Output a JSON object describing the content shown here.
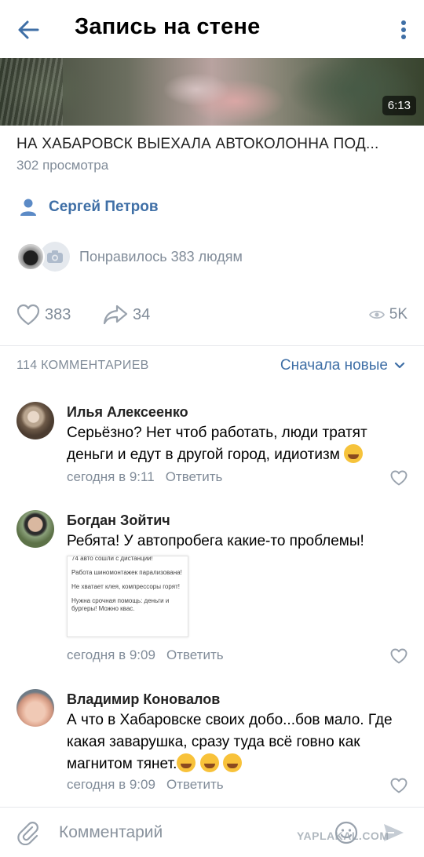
{
  "header": {
    "title": "Запись на стене"
  },
  "video": {
    "duration": "6:13",
    "title": "НА ХАБАРОВСК ВЫЕХАЛА АВТОКОЛОННА ПОД...",
    "views": "302 просмотра"
  },
  "author": {
    "name": "Сергей Петров"
  },
  "likes_summary": {
    "text": "Понравилось 383 людям"
  },
  "actions": {
    "likes": "383",
    "shares": "34",
    "views": "5K"
  },
  "comments_section": {
    "count_label": "114 КОММЕНТАРИЕВ",
    "sort_label": "Сначала новые"
  },
  "comments": [
    {
      "name": "Илья Алексеенко",
      "text_line1": "Серьёзно? Нет чтоб работать, люди тратят",
      "text_line2": "деньги и едут в другой город, идиотизм",
      "time": "сегодня в 9:11",
      "reply": "Ответить"
    },
    {
      "name": "Богдан Зойтич",
      "text_line1": "Ребята! У автопробега какие-то проблемы!",
      "attachment": [
        "74 авто сошли с дистанции!",
        "Работа шиномонтажек парализована!",
        "Не хватает клея, компрессоры горят!",
        "Нужна срочная помощь: деньги и бургеры! Можно квас."
      ],
      "time": "сегодня в 9:09",
      "reply": "Ответить"
    },
    {
      "name": "Владимир Коновалов",
      "text_line1": "А что в Хабаровске своих добо...бов мало. Где",
      "text_line2": "какая заварушка, сразу туда всё говно как",
      "text_line3": "магнитом тянет.",
      "time": "сегодня в 9:09",
      "reply": "Ответить"
    }
  ],
  "composer": {
    "placeholder": "Комментарий"
  },
  "watermark": "YAPLAKAL.COM",
  "colors": {
    "accent": "#3f6fa6",
    "secondary_text": "#818c99",
    "divider": "#e7e8ec"
  }
}
